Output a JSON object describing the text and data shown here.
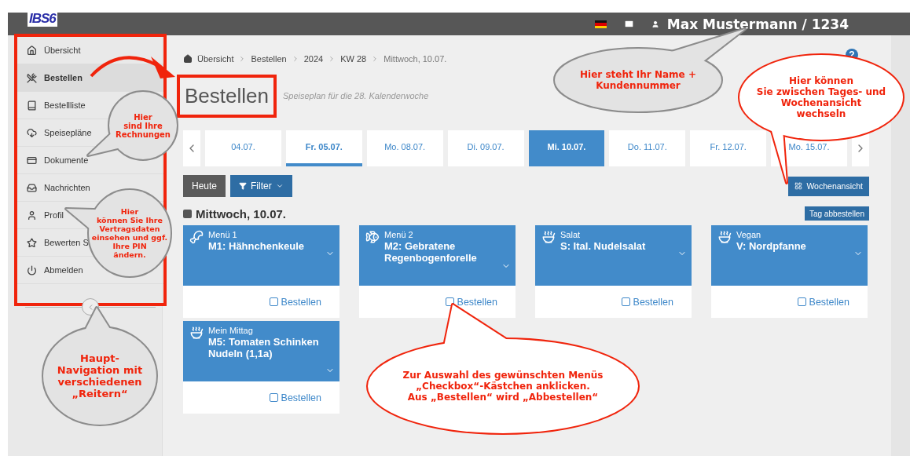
{
  "header": {
    "logo": "IBS6",
    "user": "Max Mustermann / 1234"
  },
  "sidebar": {
    "items": [
      {
        "label": "Übersicht",
        "selected": false
      },
      {
        "label": "Bestellen",
        "selected": true
      },
      {
        "label": "Bestellliste",
        "selected": false
      },
      {
        "label": "Speisepläne",
        "selected": false
      },
      {
        "label": "Dokumente",
        "selected": false
      },
      {
        "label": "Nachrichten",
        "selected": false
      },
      {
        "label": "Profil",
        "selected": false
      },
      {
        "label": "Bewerten S",
        "selected": false
      },
      {
        "label": "Abmelden",
        "selected": false
      }
    ]
  },
  "breadcrumb": [
    {
      "label": "Übersicht",
      "current": false
    },
    {
      "label": "Bestellen",
      "current": false
    },
    {
      "label": "2024",
      "current": false
    },
    {
      "label": "KW 28",
      "current": false
    },
    {
      "label": "Mittwoch, 10.07.",
      "current": true
    }
  ],
  "help": "?",
  "page": {
    "title": "Bestellen",
    "subtitle": "Speiseplan für die 28. Kalenderwoche"
  },
  "day_tabs": [
    {
      "label": "04.07.",
      "selected": false,
      "today": false
    },
    {
      "label": "Fr. 05.07.",
      "selected": false,
      "today": true
    },
    {
      "label": "Mo. 08.07.",
      "selected": false,
      "today": false
    },
    {
      "label": "Di. 09.07.",
      "selected": false,
      "today": false
    },
    {
      "label": "Mi. 10.07.",
      "selected": true,
      "today": false
    },
    {
      "label": "Do. 11.07.",
      "selected": false,
      "today": false
    },
    {
      "label": "Fr. 12.07.",
      "selected": false,
      "today": false
    },
    {
      "label": "Mo. 15.07.",
      "selected": false,
      "today": false
    }
  ],
  "toolbar": {
    "today_button": "Heute",
    "filter_button": "Filter",
    "view_button": "Wochenansicht",
    "cancel_day_button": "Tag abbestellen"
  },
  "day": {
    "heading": "Mittwoch, 10.07.",
    "checked": true
  },
  "menus": [
    {
      "kind": "poultry",
      "category": "Menü 1",
      "name": "M1: Hähnchenkeule",
      "order_label": "Bestellen",
      "checked": false
    },
    {
      "kind": "fish",
      "category": "Menü 2",
      "name": "M2: Gebratene Regenbogenforelle",
      "order_label": "Bestellen",
      "checked": false
    },
    {
      "kind": "dish",
      "category": "Salat",
      "name": "S: Ital. Nudelsalat",
      "order_label": "Bestellen",
      "checked": false
    },
    {
      "kind": "dish",
      "category": "Vegan",
      "name": "V: Nordpfanne",
      "order_label": "Bestellen",
      "checked": false
    },
    {
      "kind": "dish",
      "category": "Mein Mittag",
      "name": "M5: Tomaten Schinken Nudeln (1,1a)",
      "order_label": "Bestellen",
      "checked": false
    }
  ],
  "callouts": [
    {
      "kind": "gray",
      "text": "Hier\nsind Ihre\nRechnungen"
    },
    {
      "kind": "gray",
      "text": "Hier\nkönnen Sie Ihre\nVertragsdaten\neinsehen und ggf.\nIhre PIN\nändern."
    },
    {
      "kind": "gray",
      "text": "Haupt-\nNavigation mit\nverschiedenen\n„Reitern“"
    },
    {
      "kind": "gray",
      "text": "Hier steht Ihr Name +\nKundennummer"
    },
    {
      "kind": "red",
      "text": "Hier können\nSie zwischen Tages- und\nWochenansicht\nwechseln"
    },
    {
      "kind": "red",
      "text": "Zur Auswahl des gewünschten Menüs\n„Checkbox“-Kästchen anklicken.\nAus „Bestellen“ wird „Abbestellen“"
    }
  ]
}
